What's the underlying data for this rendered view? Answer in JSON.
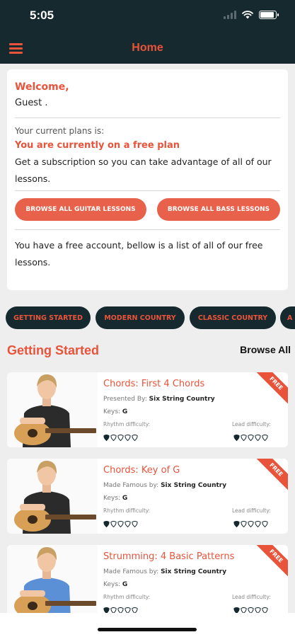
{
  "status_bar": {
    "time": "5:05",
    "battery_level": 0.9
  },
  "nav": {
    "title": "Home",
    "menu_icon": "hamburger-menu-icon"
  },
  "welcome": {
    "title": "Welcome,",
    "name": "Guest .",
    "plan_label": "Your current plans is:",
    "plan_status": "You are currently on a free plan",
    "plan_desc": "Get a subscription so you can take advantage of all of our lessons.",
    "guitar_button": "BROWSE ALL GUITAR LESSONS",
    "bass_button": "BROWSE ALL BASS LESSONS",
    "free_note": "You have a free account, bellow is a list of all of our free lessons."
  },
  "categories": [
    "GETTING STARTED",
    "MODERN COUNTRY",
    "CLASSIC COUNTRY",
    "A"
  ],
  "section": {
    "title": "Getting Started",
    "browse_all": "Browse All"
  },
  "lessons": [
    {
      "title": "Chords: First 4 Chords",
      "by_label": "Presented By:",
      "by_value": "Six String Country",
      "keys_label": "Keys:",
      "keys_value": "G",
      "rhythm_label": "Rhythm difficulty:",
      "lead_label": "Lead difficulty:",
      "rhythm_level": 1,
      "lead_level": 1,
      "badge": "FREE",
      "shirt_color": "#2b2b2b"
    },
    {
      "title": "Chords: Key of G",
      "by_label": "Made Famous by:",
      "by_value": "Six String Country",
      "keys_label": "Keys:",
      "keys_value": "G",
      "rhythm_label": "Rhythm difficulty:",
      "lead_label": "Lead difficulty:",
      "rhythm_level": 1,
      "lead_level": 1,
      "badge": "FREE",
      "shirt_color": "#2b2b2b"
    },
    {
      "title": "Strumming: 4 Basic Patterns",
      "by_label": "Made Famous by:",
      "by_value": "Six String Country",
      "keys_label": "Keys:",
      "keys_value": "G",
      "rhythm_label": "Rhythm difficulty:",
      "lead_label": "Lead difficulty:",
      "rhythm_level": 1,
      "lead_level": 1,
      "badge": "FREE",
      "shirt_color": "#5b8fd6"
    }
  ],
  "colors": {
    "accent": "#e8533a",
    "dark": "#16292f",
    "background": "#eeeeee"
  }
}
